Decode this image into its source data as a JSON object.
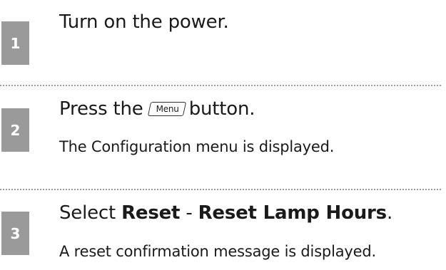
{
  "steps": [
    {
      "number": "1",
      "instruction": "Turn on the power."
    },
    {
      "number": "2",
      "instruction_before": "Press the",
      "key_label": "Menu",
      "instruction_after": "button.",
      "result": "The Configuration menu is displayed."
    },
    {
      "number": "3",
      "instruction_prefix": "Select ",
      "menu_item_1": "Reset",
      "separator": " - ",
      "menu_item_2": "Reset Lamp Hours",
      "instruction_suffix": ".",
      "result": "A reset confirmation message is displayed."
    }
  ],
  "colors": {
    "badge_bg": "#9a9a9a",
    "text": "#1a1a1a",
    "divider": "#9a9a9a"
  }
}
